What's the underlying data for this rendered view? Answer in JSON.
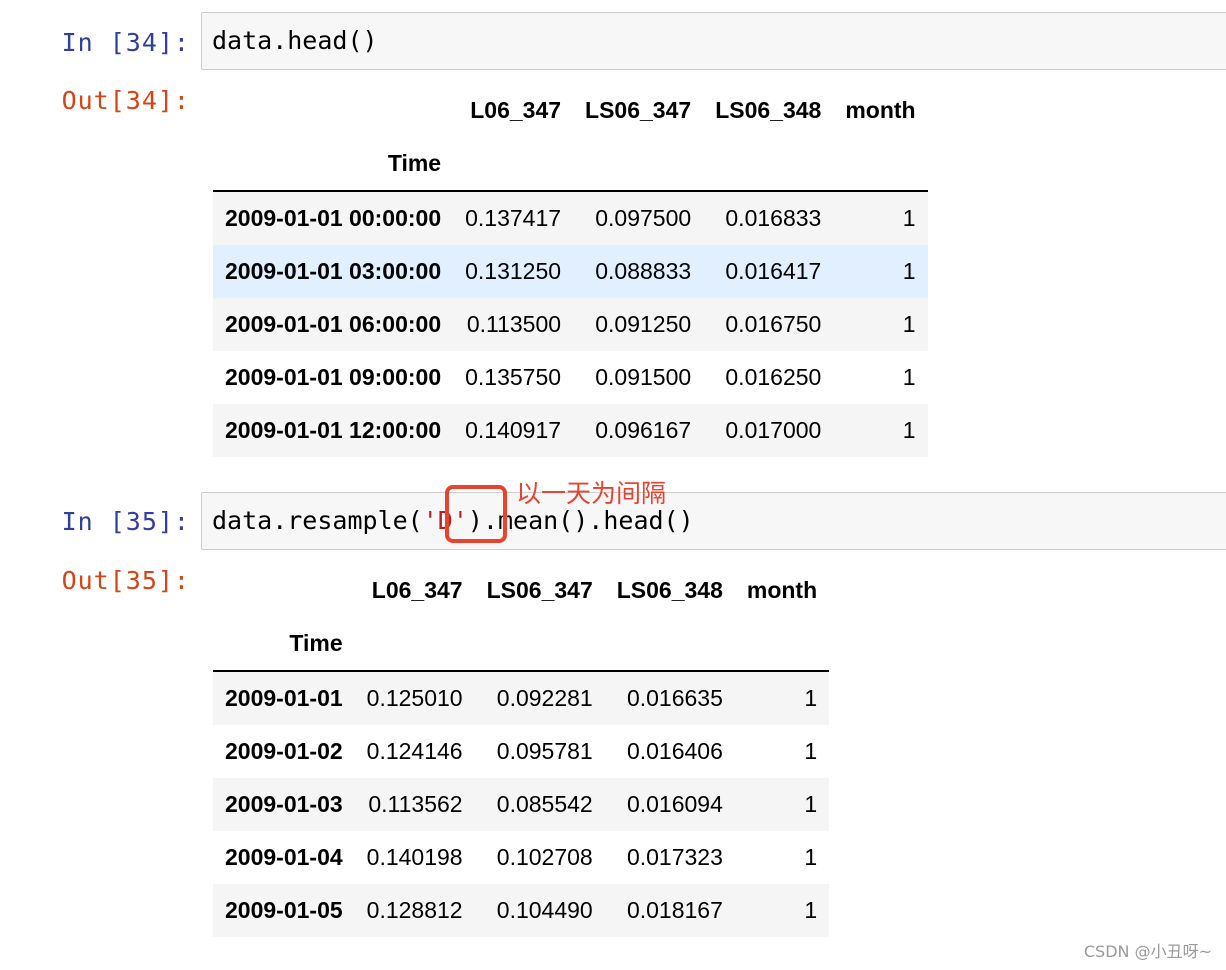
{
  "cells": [
    {
      "in_prompt": "In [34]:",
      "code": {
        "pre": "data.head()",
        "str": "",
        "post": ""
      },
      "out_prompt": "Out[34]:",
      "table": {
        "columns": [
          "L06_347",
          "LS06_347",
          "LS06_348",
          "month"
        ],
        "index_name": "Time",
        "rows": [
          [
            "2009-01-01 00:00:00",
            "0.137417",
            "0.097500",
            "0.016833",
            "1"
          ],
          [
            "2009-01-01 03:00:00",
            "0.131250",
            "0.088833",
            "0.016417",
            "1"
          ],
          [
            "2009-01-01 06:00:00",
            "0.113500",
            "0.091250",
            "0.016750",
            "1"
          ],
          [
            "2009-01-01 09:00:00",
            "0.135750",
            "0.091500",
            "0.016250",
            "1"
          ],
          [
            "2009-01-01 12:00:00",
            "0.140917",
            "0.096167",
            "0.017000",
            "1"
          ]
        ]
      }
    },
    {
      "in_prompt": "In [35]:",
      "code": {
        "pre": "data.resample(",
        "str": "'D'",
        "post": ").mean().head()"
      },
      "out_prompt": "Out[35]:",
      "table": {
        "columns": [
          "L06_347",
          "LS06_347",
          "LS06_348",
          "month"
        ],
        "index_name": "Time",
        "rows": [
          [
            "2009-01-01",
            "0.125010",
            "0.092281",
            "0.016635",
            "1"
          ],
          [
            "2009-01-02",
            "0.124146",
            "0.095781",
            "0.016406",
            "1"
          ],
          [
            "2009-01-03",
            "0.113562",
            "0.085542",
            "0.016094",
            "1"
          ],
          [
            "2009-01-04",
            "0.140198",
            "0.102708",
            "0.017323",
            "1"
          ],
          [
            "2009-01-05",
            "0.128812",
            "0.104490",
            "0.018167",
            "1"
          ]
        ]
      }
    }
  ],
  "annotation": "以一天为间隔",
  "watermark": "CSDN @小丑呀~",
  "colors": {
    "prompt_in": "#303f9f",
    "prompt_out": "#d84315",
    "string": "#ba2121",
    "annotation": "#e8432f",
    "row_hover": "#e1efff",
    "row_stripe": "#f5f5f5"
  }
}
